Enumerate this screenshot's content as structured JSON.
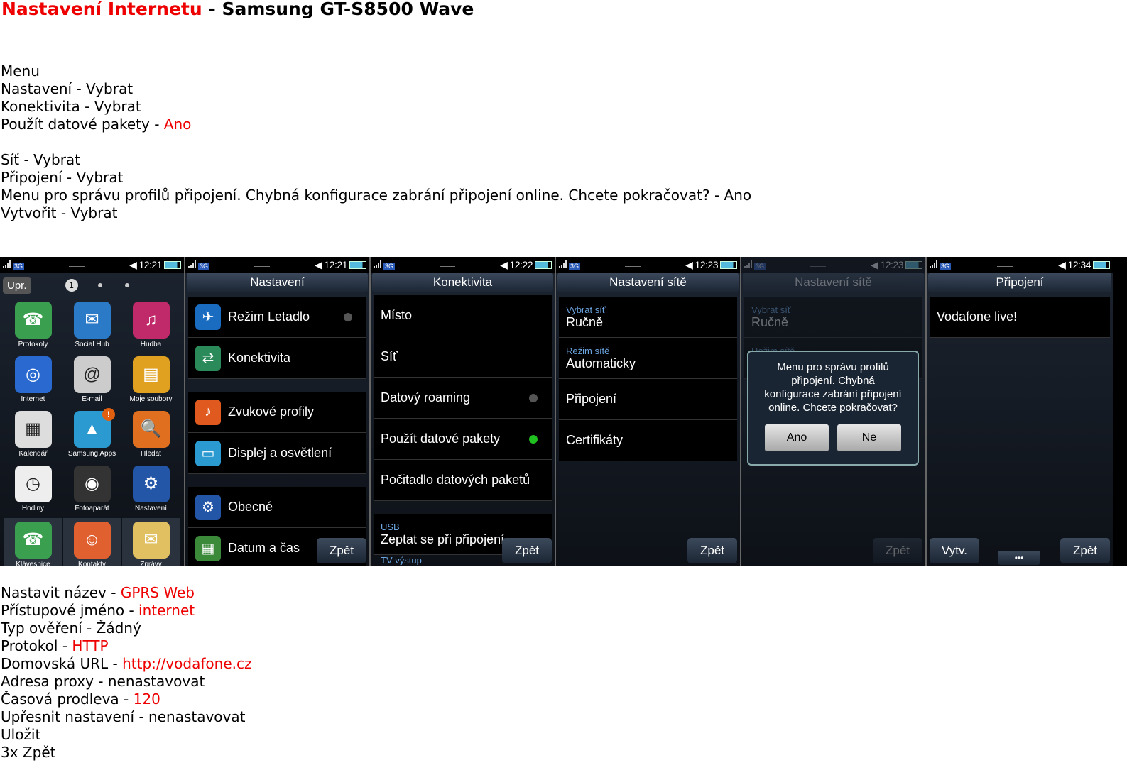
{
  "header": {
    "title_red": "Nastavení Internetu",
    "title_rest": " - Samsung GT-S8500 Wave"
  },
  "steps_top": [
    {
      "t": "Menu"
    },
    {
      "t": "Nastavení - Vybrat"
    },
    {
      "t": "Konektivita - Vybrat"
    },
    {
      "t": "Použít datové pakety - ",
      "r": "Ano"
    },
    {
      "t": ""
    },
    {
      "t": "Síť - Vybrat"
    },
    {
      "t": "Připojení - Vybrat"
    },
    {
      "t": "Menu pro správu profilů připojení. Chybná konfigurace zabrání připojení online. Chcete pokračovat? - Ano"
    },
    {
      "t": "Vytvořit - Vybrat"
    }
  ],
  "steps_bottom": [
    {
      "t": "Nastavit název - ",
      "r": "GPRS Web"
    },
    {
      "t": "Přístupové jméno - ",
      "r": "internet"
    },
    {
      "t": "Typ ověření - Žádný"
    },
    {
      "t": "Protokol - ",
      "r": "HTTP"
    },
    {
      "t": "Domovská URL - ",
      "r": "http://vodafone.cz"
    },
    {
      "t": "Adresa proxy - nenastavovat"
    },
    {
      "t": "Časová prodleva - ",
      "r": "120"
    },
    {
      "t": "Upřesnit nastavení - nenastavovat"
    },
    {
      "t": "Uložit"
    },
    {
      "t": "3x Zpět"
    }
  ],
  "phone": {
    "network": "3G",
    "back": "Zpět",
    "create": "Vytv.",
    "more": "•••"
  },
  "screen1": {
    "time": "12:21",
    "edit": "Upr.",
    "page": "1",
    "apps": [
      "Protokoly",
      "Social Hub",
      "Hudba",
      "Internet",
      "E-mail",
      "Moje soubory",
      "Kalendář",
      "Samsung Apps",
      "Hledat",
      "Hodiny",
      "Fotoaparát",
      "Nastavení",
      "Klávesnice",
      "Kontakty",
      "Zprávy"
    ],
    "badge": "!"
  },
  "screen2": {
    "time": "12:21",
    "title": "Nastavení",
    "items": [
      "Režim Letadlo",
      "Konektivita",
      "Zvukové profily",
      "Displej a osvětlení",
      "Obecné",
      "Datum a čas"
    ]
  },
  "screen3": {
    "time": "12:22",
    "title": "Konektivita",
    "items": [
      "Místo",
      "Síť",
      "Datový roaming",
      "Použít datové pakety",
      "Počitadlo datových paketů"
    ],
    "usb_label": "USB",
    "usb_value": "Zeptat se při připojení",
    "tv": "TV výstup"
  },
  "screen4": {
    "time": "12:23",
    "title": "Nastavení sítě",
    "sel_label": "Vybrat síť",
    "sel_value": "Ručně",
    "mode_label": "Režim sítě",
    "mode_value": "Automaticky",
    "items": [
      "Připojení",
      "Certifikáty"
    ]
  },
  "screen5": {
    "time": "12:23",
    "title": "Nastavení sítě",
    "dialog": [
      "Menu pro správu profilů",
      "připojení. Chybná",
      "konfigurace zabrání připojení",
      "online. Chcete pokračovat?"
    ],
    "yes": "Ano",
    "no": "Ne"
  },
  "screen6": {
    "time": "12:34",
    "title": "Připojení",
    "items": [
      "Vodafone live!"
    ]
  },
  "colors": {
    "accent_red": "#e00000",
    "sub_blue": "#6ba4e0",
    "toggle_on": "#20c020",
    "toggle_off": "#555555"
  }
}
